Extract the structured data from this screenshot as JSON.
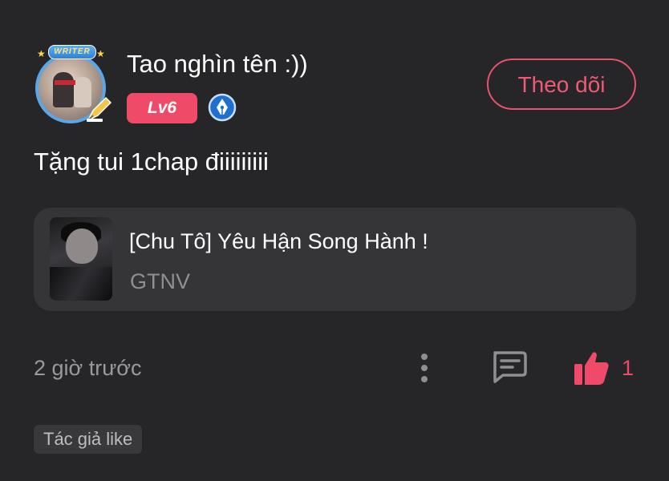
{
  "comment": {
    "user": {
      "name": "Tao nghìn tên :))",
      "badge_text": "WRITER",
      "level": "Lv6",
      "verified_icon": "pen-nib-shield-icon"
    },
    "follow_label": "Theo dõi",
    "text": "Tặng tui 1chap điiiiiiiii",
    "book": {
      "title": "[Chu Tô] Yêu Hận Song Hành !",
      "author": "GTNV"
    },
    "timestamp": "2 giờ trước",
    "actions": {
      "more_icon": "more-vertical-icon",
      "reply_icon": "comment-icon",
      "like_icon": "thumbs-up-icon",
      "like_count": "1"
    },
    "author_like_tag": "Tác giả like"
  },
  "colors": {
    "background": "#262527",
    "accent": "#ef4a68",
    "card": "#353437",
    "muted_text": "#9a999d"
  }
}
